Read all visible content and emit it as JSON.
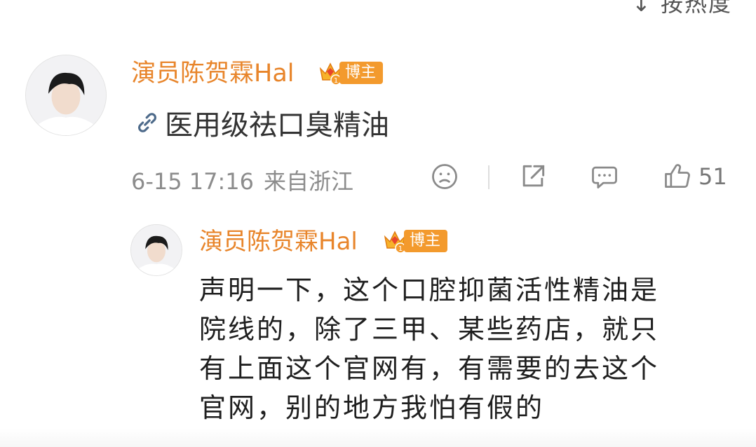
{
  "header": {
    "sort_label": "↓ 按热度"
  },
  "comment": {
    "username": "演员陈贺霖Hal",
    "badge_level": "1",
    "badge_label": "博主",
    "link_text": "医用级祛口臭精油",
    "time": "6-15 17:16",
    "location": "来自浙江",
    "like_count": "51",
    "icons": [
      "emoji-icon",
      "share-icon",
      "comment-icon",
      "like-icon"
    ]
  },
  "reply": {
    "username": "演员陈贺霖Hal",
    "badge_level": "1",
    "badge_label": "博主",
    "lines": [
      "声明一下，这个口腔抑菌活性精油是",
      "院线的，除了三甲、某些药店，就只",
      "有上面这个官网有，有需要的去这个",
      "官网，别的地方我怕有假的"
    ]
  },
  "colors": {
    "username": "#e8852b",
    "badge": "#f39a2d",
    "meta": "#8c8c8c"
  }
}
